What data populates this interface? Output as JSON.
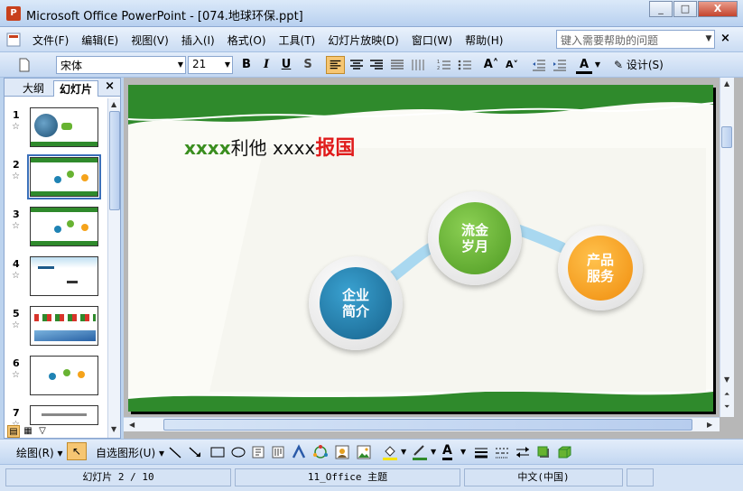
{
  "window": {
    "title": "Microsoft Office PowerPoint - [074.地球环保.ppt]",
    "app_icon": "P",
    "min": "_",
    "max": "□",
    "close": "X"
  },
  "menu": {
    "items": [
      "文件(F)",
      "编辑(E)",
      "视图(V)",
      "插入(I)",
      "格式(O)",
      "工具(T)",
      "幻灯片放映(D)",
      "窗口(W)",
      "帮助(H)"
    ],
    "help_placeholder": "键入需要帮助的问题",
    "doc_close": "×"
  },
  "toolbar": {
    "font_name": "宋体",
    "font_size": "21",
    "bold": "B",
    "italic": "I",
    "underline": "U",
    "shadow": "S",
    "design": "设计(S)"
  },
  "left_pane": {
    "tab_outline": "大纲",
    "tab_slides": "幻灯片",
    "close": "×",
    "slides": [
      "1",
      "2",
      "3",
      "4",
      "5",
      "6",
      "7"
    ],
    "star": "☆",
    "selected_index": 2
  },
  "slide": {
    "title_green": "xxxx",
    "title_mid": "利他   xxxx",
    "title_red": "报国",
    "circle1": "企业\n简介",
    "circle2": "流金\n岁月",
    "circle3": "产品\n服务",
    "colors": {
      "band": "#2f8a2c",
      "blue": "#1f83b4",
      "green": "#68b332",
      "orange": "#f5a31b",
      "red": "#e01b1b"
    }
  },
  "drawbar": {
    "draw": "绘图(R)",
    "autoshapes": "自选图形(U)"
  },
  "status": {
    "slide": "幻灯片 2 / 10",
    "theme": "11_Office 主题",
    "lang": "中文(中国)"
  }
}
